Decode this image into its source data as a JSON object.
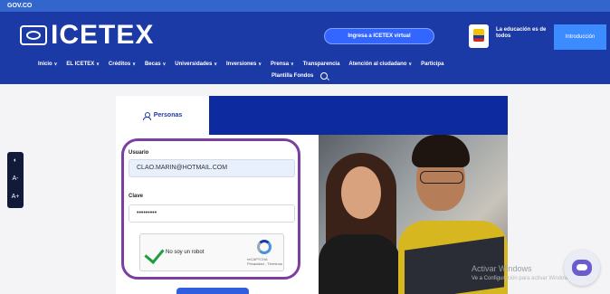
{
  "gov_bar": {
    "label": "GOV.CO"
  },
  "header": {
    "logo_text": "ICETEX",
    "virtual_button": "Ingresa a ICETEX virtual",
    "education_text": "La educación es de todos",
    "intro_button": "Introducción"
  },
  "nav": {
    "items": [
      {
        "label": "Inicio",
        "dropdown": true
      },
      {
        "label": "EL ICETEX",
        "dropdown": true
      },
      {
        "label": "Créditos",
        "dropdown": true
      },
      {
        "label": "Becas",
        "dropdown": true
      },
      {
        "label": "Universidades",
        "dropdown": true
      },
      {
        "label": "Inversiones",
        "dropdown": true
      },
      {
        "label": "Prensa",
        "dropdown": true
      },
      {
        "label": "Transparencia",
        "dropdown": false
      },
      {
        "label": "Atención al ciudadano",
        "dropdown": true
      },
      {
        "label": "Participa",
        "dropdown": false
      }
    ],
    "second_row": "Plantilla Fondos"
  },
  "accessibility": {
    "contrast": "◐",
    "decrease": "A-",
    "increase": "A+"
  },
  "login": {
    "tab_label": "Personas",
    "user_label": "Usuario",
    "user_value": "CLAO.MARIN@HOTMAIL.COM",
    "password_label": "Clave",
    "password_value": "•••••••••",
    "recaptcha_label": "No soy un robot",
    "recaptcha_brand": "reCAPTCHA",
    "recaptcha_links": "Privacidad - Términos"
  },
  "watermark": {
    "title": "Activar Windows",
    "subtitle": "Ve a Configuración para activar Windows."
  },
  "colors": {
    "header_blue": "#1c3aa6",
    "dark_blue": "#0d2a9e",
    "highlight": "#7b3fa0"
  }
}
